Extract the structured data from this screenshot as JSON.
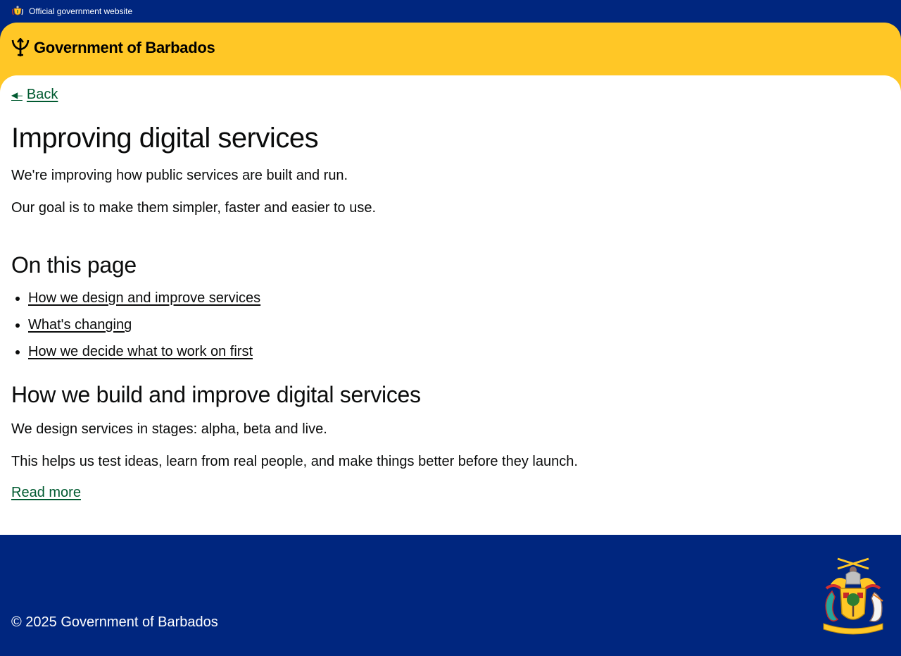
{
  "topbar": {
    "official_text": "Official government website"
  },
  "header": {
    "brand": "Government of Barbados"
  },
  "nav": {
    "back_label": "Back"
  },
  "page": {
    "title": "Improving digital services",
    "intro": [
      "We're improving how public services are built and run.",
      "Our goal is to make them simpler, faster and easier to use."
    ]
  },
  "on_this_page": {
    "heading": "On this page",
    "links": [
      "How we design and improve services",
      "What's changing",
      "How we decide what to work on first"
    ]
  },
  "section": {
    "heading": "How we build and improve digital services",
    "paragraphs": [
      "We design services in stages: alpha, beta and live.",
      "This helps us test ideas, learn from real people, and make things better before they launch."
    ],
    "read_more": "Read more"
  },
  "footer": {
    "copyright": "© 2025 Government of Barbados"
  },
  "colors": {
    "navy": "#00267f",
    "gold": "#ffc726",
    "link_green": "#005a30"
  }
}
